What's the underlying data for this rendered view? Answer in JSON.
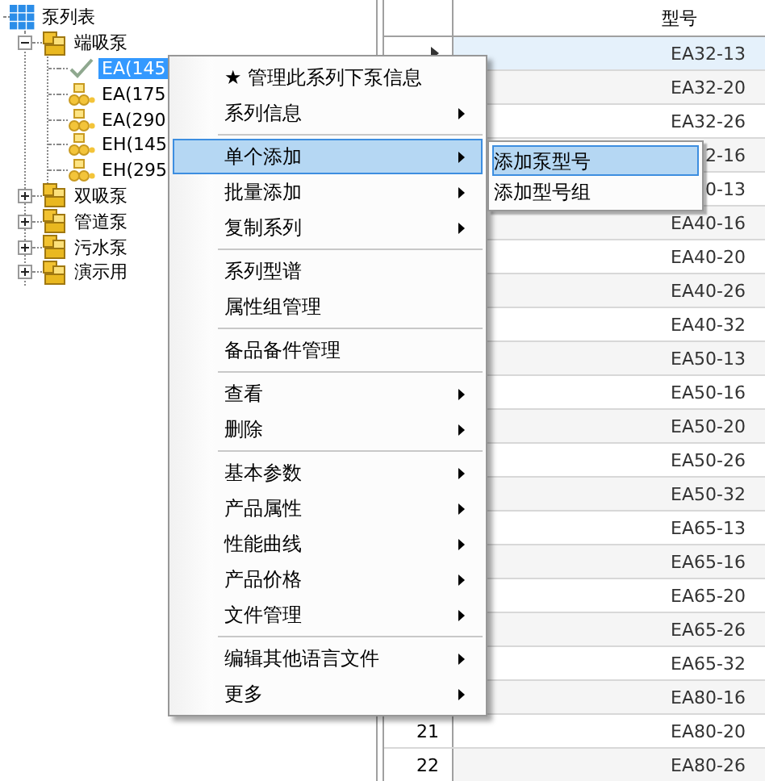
{
  "tree": {
    "label": "泵列表",
    "kind": "root",
    "selected": false,
    "children": [
      {
        "label": "端吸泵",
        "kind": "group",
        "selected": false,
        "expanded": true,
        "children": [
          {
            "label": "EA(145",
            "kind": "checked-series",
            "selected": true
          },
          {
            "label": "EA(175",
            "kind": "series",
            "selected": false
          },
          {
            "label": "EA(290",
            "kind": "series",
            "selected": false
          },
          {
            "label": "EH(145",
            "kind": "series",
            "selected": false
          },
          {
            "label": "EH(295",
            "kind": "series",
            "selected": false
          }
        ]
      },
      {
        "label": "双吸泵",
        "kind": "group",
        "selected": false,
        "expanded": false
      },
      {
        "label": "管道泵",
        "kind": "group",
        "selected": false,
        "expanded": false
      },
      {
        "label": "污水泵",
        "kind": "group",
        "selected": false,
        "expanded": false
      },
      {
        "label": "演示用",
        "kind": "group",
        "selected": false,
        "expanded": false
      }
    ]
  },
  "grid": {
    "columns": [
      "型号"
    ],
    "rows": [
      {
        "model": "EA32-13",
        "selected": true
      },
      {
        "model": "EA32-20",
        "selected": false
      },
      {
        "model": "EA32-26",
        "selected": false
      },
      {
        "model": "2-16",
        "selected": false
      },
      {
        "model": "0-13",
        "selected": false
      },
      {
        "model": "EA40-16",
        "selected": false
      },
      {
        "model": "EA40-20",
        "selected": false
      },
      {
        "model": "EA40-26",
        "selected": false
      },
      {
        "model": "EA40-32",
        "selected": false
      },
      {
        "model": "EA50-13",
        "selected": false
      },
      {
        "model": "EA50-16",
        "selected": false
      },
      {
        "model": "EA50-20",
        "selected": false
      },
      {
        "model": "EA50-26",
        "selected": false
      },
      {
        "model": "EA50-32",
        "selected": false
      },
      {
        "model": "EA65-13",
        "selected": false
      },
      {
        "model": "EA65-16",
        "selected": false
      },
      {
        "model": "EA65-20",
        "selected": false
      },
      {
        "model": "EA65-26",
        "selected": false
      },
      {
        "model": "EA65-32",
        "selected": false
      },
      {
        "model": "EA80-16",
        "selected": false
      },
      {
        "number": "21",
        "model": "EA80-20",
        "selected": false
      },
      {
        "number": "22",
        "model": "EA80-26",
        "selected": false
      }
    ]
  },
  "context_menu": {
    "items": [
      {
        "kind": "item",
        "label": "★ 管理此系列下泵信息",
        "submenu": false,
        "selected": false
      },
      {
        "kind": "item",
        "label": "系列信息",
        "submenu": true,
        "selected": false
      },
      {
        "kind": "separator"
      },
      {
        "kind": "item",
        "label": "单个添加",
        "submenu": true,
        "selected": true
      },
      {
        "kind": "item",
        "label": "批量添加",
        "submenu": true,
        "selected": false
      },
      {
        "kind": "item",
        "label": "复制系列",
        "submenu": true,
        "selected": false
      },
      {
        "kind": "separator"
      },
      {
        "kind": "item",
        "label": "系列型谱",
        "submenu": false,
        "selected": false
      },
      {
        "kind": "item",
        "label": "属性组管理",
        "submenu": false,
        "selected": false
      },
      {
        "kind": "separator"
      },
      {
        "kind": "item",
        "label": "备品备件管理",
        "submenu": false,
        "selected": false
      },
      {
        "kind": "separator"
      },
      {
        "kind": "item",
        "label": "查看",
        "submenu": true,
        "selected": false
      },
      {
        "kind": "item",
        "label": "删除",
        "submenu": true,
        "selected": false
      },
      {
        "kind": "separator"
      },
      {
        "kind": "item",
        "label": "基本参数",
        "submenu": true,
        "selected": false
      },
      {
        "kind": "item",
        "label": "产品属性",
        "submenu": true,
        "selected": false
      },
      {
        "kind": "item",
        "label": "性能曲线",
        "submenu": true,
        "selected": false
      },
      {
        "kind": "item",
        "label": "产品价格",
        "submenu": true,
        "selected": false
      },
      {
        "kind": "item",
        "label": "文件管理",
        "submenu": true,
        "selected": false
      },
      {
        "kind": "separator"
      },
      {
        "kind": "item",
        "label": "编辑其他语言文件",
        "submenu": true,
        "selected": false
      },
      {
        "kind": "item",
        "label": "更多",
        "submenu": true,
        "selected": false
      }
    ]
  },
  "submenu": {
    "items": [
      {
        "label": "添加泵型号",
        "selected": true
      },
      {
        "label": "添加型号组",
        "selected": false
      }
    ]
  }
}
